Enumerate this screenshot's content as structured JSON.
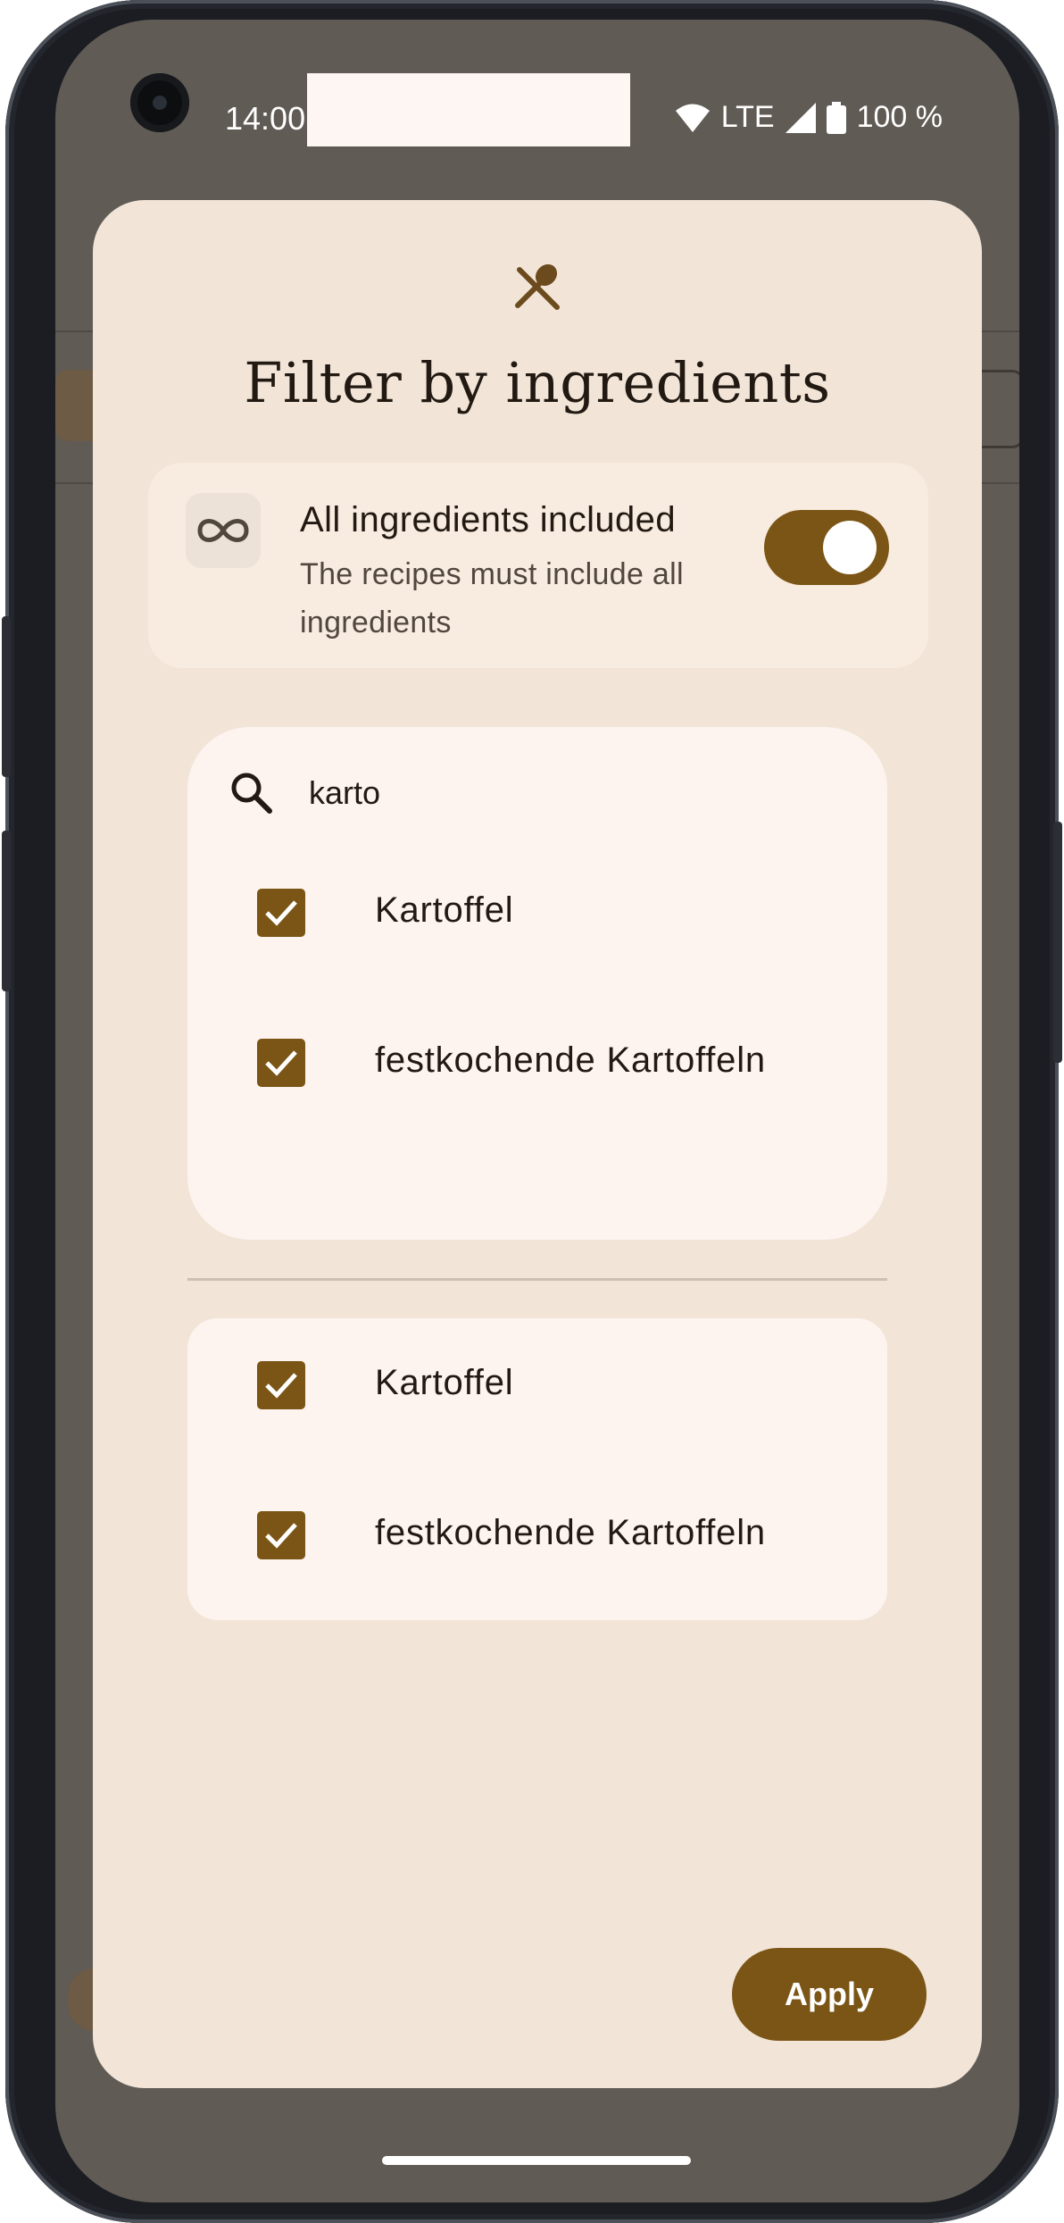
{
  "status_bar": {
    "time": "14:00",
    "network": "LTE",
    "battery": "100 %"
  },
  "dialog": {
    "title": "Filter by ingredients",
    "icon": "fork-spoon-icon",
    "all_included": {
      "title": "All ingredients included",
      "subtitle": "The recipes must include all ingredients",
      "icon": "infinity-icon",
      "enabled": true
    },
    "search": {
      "value": "karto",
      "results": [
        {
          "label": "Kartoffel",
          "checked": true
        },
        {
          "label": "festkochende Kartoffeln",
          "checked": true
        }
      ]
    },
    "selected": [
      {
        "label": "Kartoffel",
        "checked": true
      },
      {
        "label": "festkochende Kartoffeln",
        "checked": true
      }
    ],
    "apply_label": "Apply"
  },
  "colors": {
    "accent": "#7b5516",
    "dialog_bg": "#f2e5d8",
    "card_bg": "#fdf4f0",
    "scrim": "#605b55"
  }
}
